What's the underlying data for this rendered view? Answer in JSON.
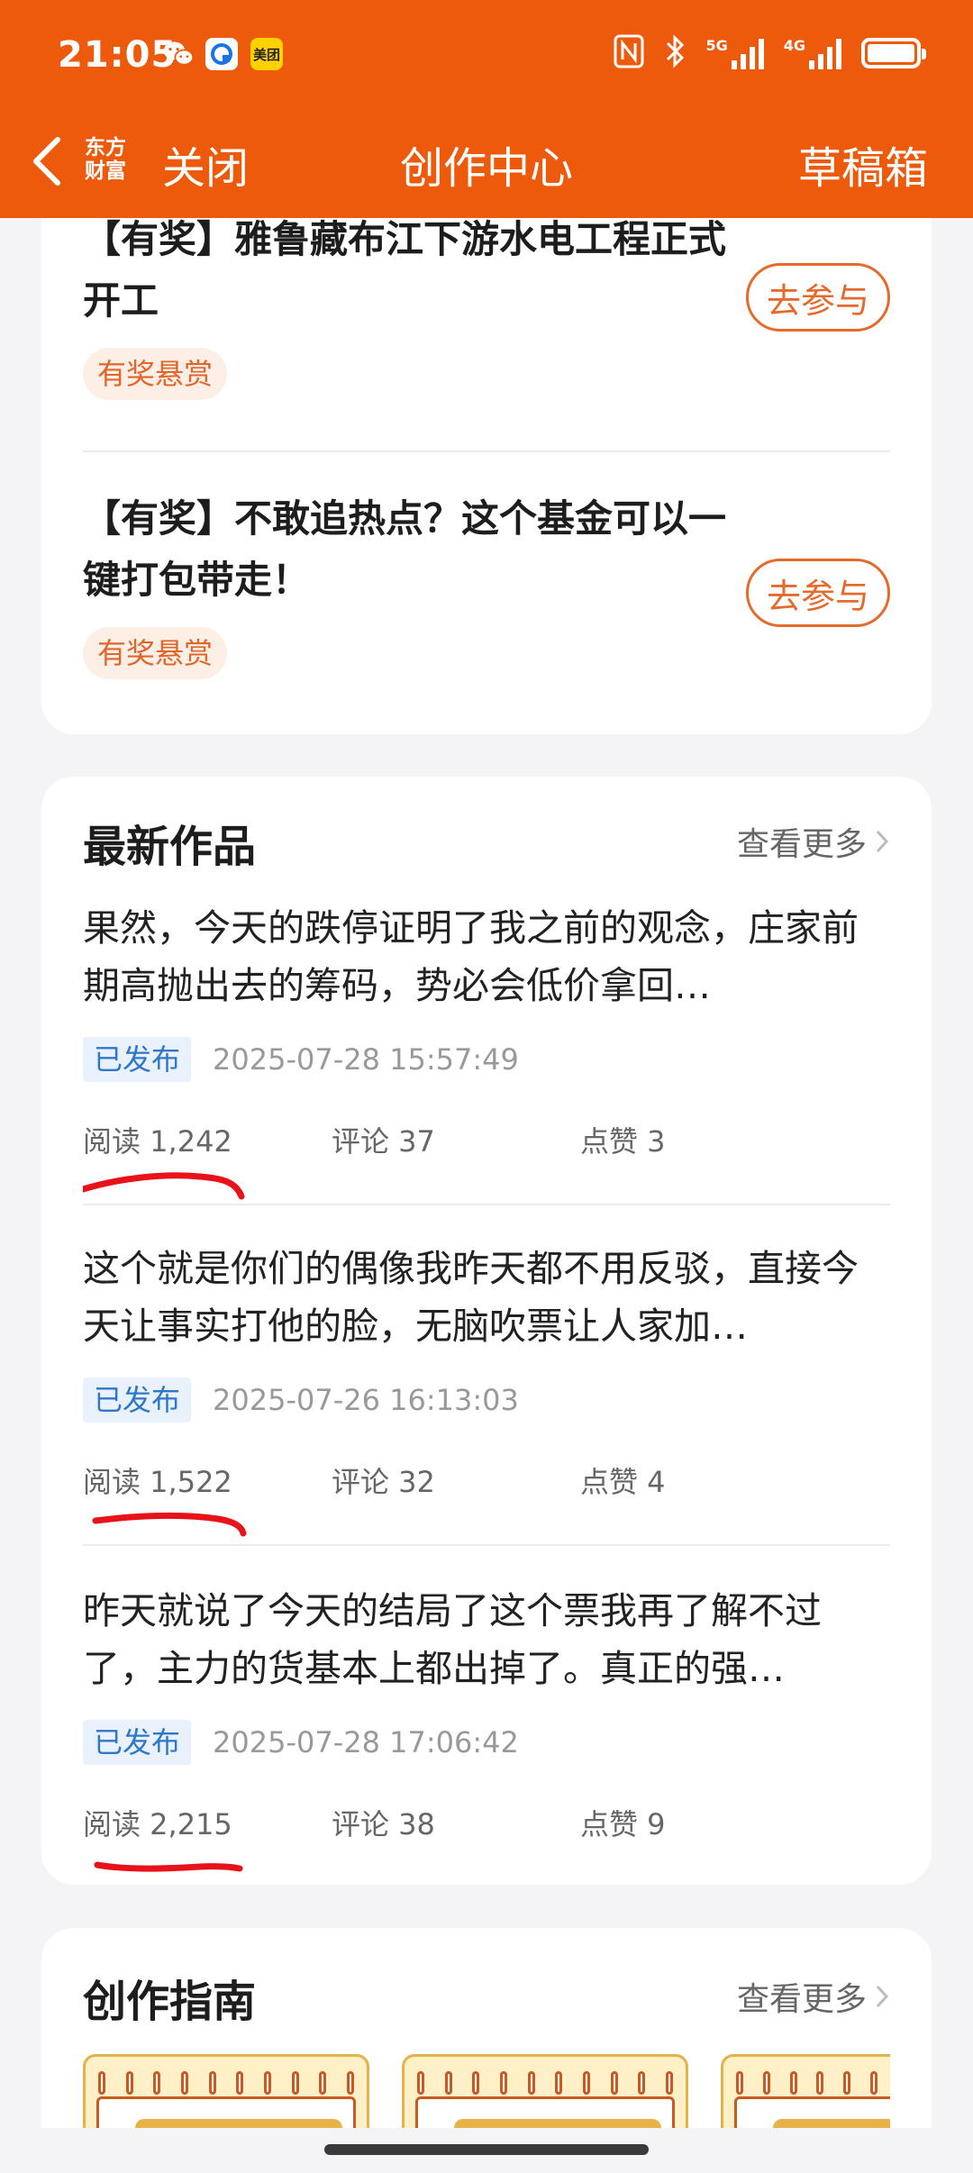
{
  "status_bar": {
    "time": "21:05",
    "icons": [
      "wechat-icon",
      "bank-app-icon",
      "meituan-icon",
      "nfc-icon",
      "bluetooth-icon",
      "signal-5g-icon",
      "signal-4g-icon",
      "battery-icon"
    ],
    "app_badges": {
      "meituan": "美团"
    },
    "network_5g": "5G",
    "network_4g": "4G"
  },
  "nav": {
    "logo_line1": "东方",
    "logo_line2": "财富",
    "close_label": "关闭",
    "title": "创作中心",
    "draft_label": "草稿箱"
  },
  "activities": [
    {
      "title": "【有奖】雅鲁藏布江下游水电工程正式开工",
      "tag": "有奖悬赏",
      "button": "去参与"
    },
    {
      "title": "【有奖】不敢追热点？这个基金可以一键打包带走！",
      "tag": "有奖悬赏",
      "button": "去参与"
    }
  ],
  "latest_works": {
    "title": "最新作品",
    "more_label": "查看更多",
    "items": [
      {
        "text": "果然，今天的跌停证明了我之前的观念，庄家前期高抛出去的筹码，势必会低价拿回…",
        "status": "已发布",
        "time": "2025-07-28 15:57:49",
        "read": "阅读 1,242",
        "comments": "评论 37",
        "likes": "点赞 3"
      },
      {
        "text": "这个就是你们的偶像我昨天都不用反驳，直接今天让事实打他的脸，无脑吹票让人家加…",
        "status": "已发布",
        "time": "2025-07-26 16:13:03",
        "read": "阅读 1,522",
        "comments": "评论 32",
        "likes": "点赞 4"
      },
      {
        "text": "昨天就说了今天的结局了这个票我再了解不过了，主力的货基本上都出掉了。真正的强…",
        "status": "已发布",
        "time": "2025-07-28 17:06:42",
        "read": "阅读 2,215",
        "comments": "评论 38",
        "likes": "点赞 9"
      }
    ]
  },
  "guide": {
    "title": "创作指南",
    "more_label": "查看更多"
  },
  "colors": {
    "brand_orange": "#ee5a0c",
    "accent_orange": "#e56a2c",
    "tag_bg": "#fdeee6",
    "published_blue": "#2f77c8",
    "annotation_red": "#e8121a"
  }
}
